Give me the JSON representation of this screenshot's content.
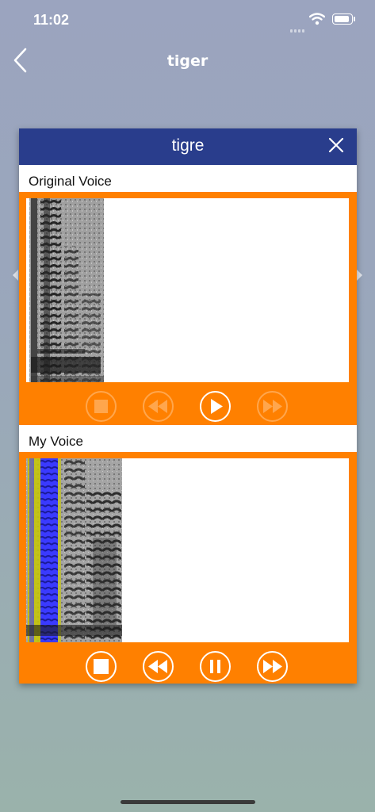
{
  "status_bar": {
    "time": "11:02"
  },
  "nav": {
    "title": "tiger",
    "back_icon": "chevron-left-icon"
  },
  "dialog": {
    "title": "tigre",
    "close_icon": "close-icon",
    "original": {
      "label": "Original Voice",
      "controls": [
        {
          "name": "stop",
          "enabled": false
        },
        {
          "name": "rewind",
          "enabled": false
        },
        {
          "name": "play",
          "enabled": true
        },
        {
          "name": "forward",
          "enabled": false
        }
      ]
    },
    "mine": {
      "label": "My Voice",
      "controls": [
        {
          "name": "stop",
          "enabled": true
        },
        {
          "name": "rewind",
          "enabled": true
        },
        {
          "name": "pause",
          "enabled": true
        },
        {
          "name": "forward",
          "enabled": true
        }
      ]
    }
  },
  "colors": {
    "header": "#293d8c",
    "panel": "#ff8000",
    "overlay_blue": "#3a3aff",
    "overlay_yellow": "#c8c800"
  }
}
